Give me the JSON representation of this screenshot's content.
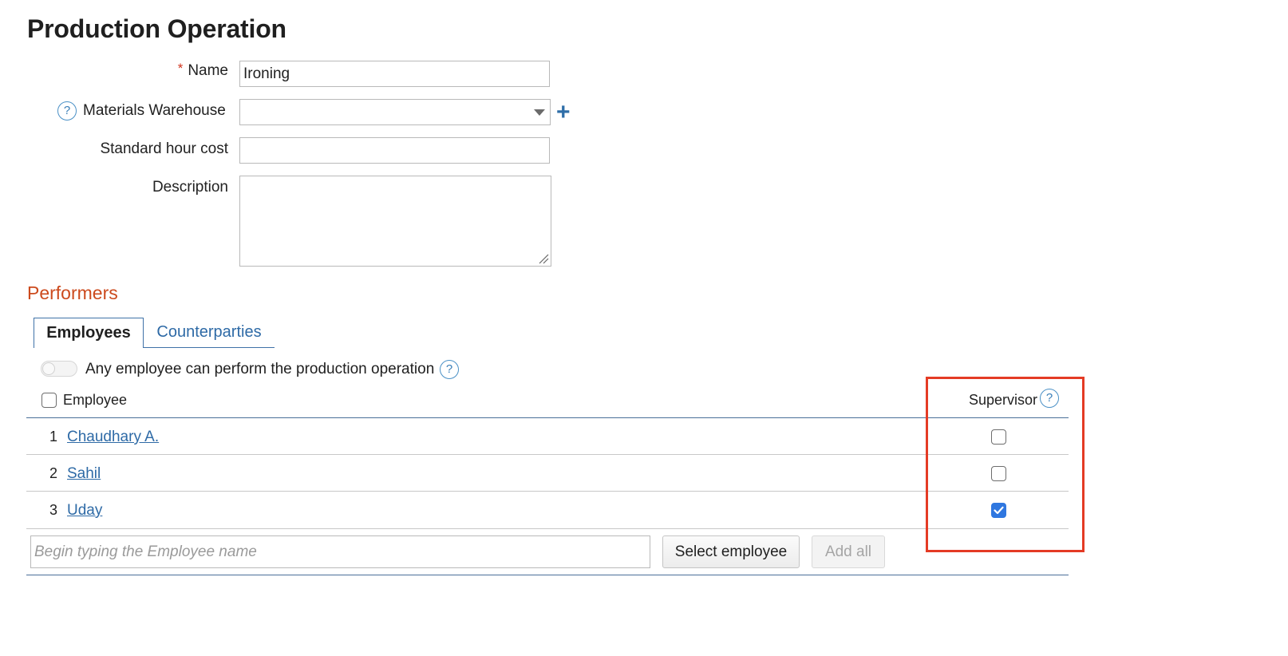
{
  "page": {
    "title": "Production Operation"
  },
  "form": {
    "name": {
      "label": "Name",
      "value": "Ironing",
      "required_mark": "*"
    },
    "materials_warehouse": {
      "label": "Materials Warehouse",
      "value": "",
      "help": "?",
      "add": "+"
    },
    "standard_hour_cost": {
      "label": "Standard hour cost",
      "value": ""
    },
    "description": {
      "label": "Description",
      "value": ""
    }
  },
  "performers": {
    "title": "Performers",
    "tabs": [
      {
        "label": "Employees",
        "active": true
      },
      {
        "label": "Counterparties",
        "active": false
      }
    ],
    "toggle": {
      "label": "Any employee can perform the production operation",
      "on": false,
      "help": "?"
    },
    "table": {
      "columns": {
        "employee": "Employee",
        "supervisor": "Supervisor",
        "help": "?"
      },
      "rows": [
        {
          "num": "1",
          "name": "Chaudhary A.",
          "supervisor": false
        },
        {
          "num": "2",
          "name": "Sahil",
          "supervisor": false
        },
        {
          "num": "3",
          "name": "Uday",
          "supervisor": true
        }
      ]
    },
    "search": {
      "placeholder": "Begin typing the Employee name"
    },
    "buttons": {
      "select": "Select employee",
      "add_all": "Add all"
    }
  },
  "colors": {
    "accent_link": "#2e6aa6",
    "section_title": "#cc4a1d",
    "highlight": "#e43b25",
    "checkbox_checked": "#2f77e0"
  },
  "icons": {
    "help": "question-circle-icon",
    "add": "plus-icon",
    "dropdown": "chevron-down-icon",
    "check": "check-icon"
  }
}
